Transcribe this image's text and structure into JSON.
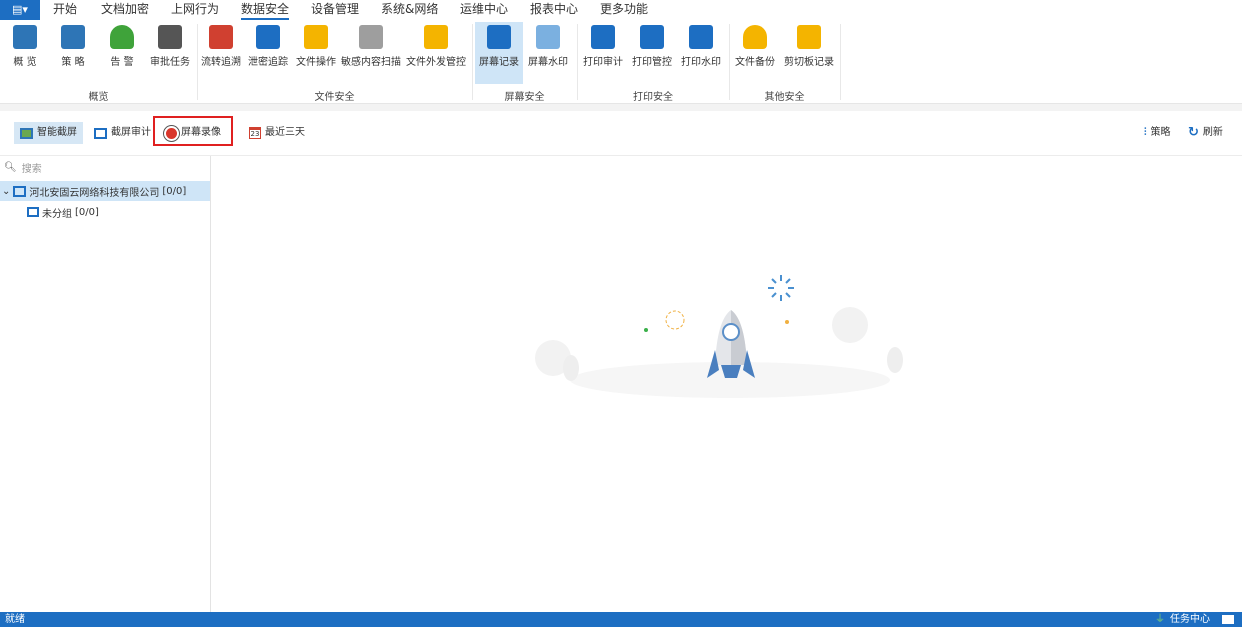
{
  "menu": {
    "app_icon": "app-menu-icon",
    "tabs": [
      "开始",
      "文档加密",
      "上网行为",
      "数据安全",
      "设备管理",
      "系统&网络",
      "运维中心",
      "报表中心",
      "更多功能"
    ],
    "active": "数据安全"
  },
  "ribbon": {
    "items": [
      {
        "label": "概 览",
        "icon": "overview-grid-icon"
      },
      {
        "label": "策 略",
        "icon": "policy-sliders-icon"
      },
      {
        "label": "告 警",
        "icon": "alarm-bell-icon"
      },
      {
        "label": "审批任务",
        "icon": "approval-clipboard-icon"
      },
      {
        "label": "流转追溯",
        "icon": "trace-flow-icon"
      },
      {
        "label": "泄密追踪",
        "icon": "leak-cloud-icon"
      },
      {
        "label": "文件操作",
        "icon": "file-operation-folder-icon"
      },
      {
        "label": "敏感内容扫描",
        "icon": "sensitive-scan-icon"
      },
      {
        "label": "文件外发管控",
        "icon": "file-outgoing-folder-icon"
      },
      {
        "label": "屏幕记录",
        "icon": "screen-record-monitor-icon"
      },
      {
        "label": "屏幕水印",
        "icon": "screen-watermark-icon"
      },
      {
        "label": "打印审计",
        "icon": "printer-icon"
      },
      {
        "label": "打印管控",
        "icon": "printer-shield-icon"
      },
      {
        "label": "打印水印",
        "icon": "print-watermark-icon"
      },
      {
        "label": "文件备份",
        "icon": "file-backup-icon"
      },
      {
        "label": "剪切板记录",
        "icon": "clipboard-icon"
      }
    ],
    "groups": [
      "概览",
      "文件安全",
      "屏幕安全",
      "打印安全",
      "其他安全"
    ]
  },
  "toolbar": {
    "smart_capture": "智能截屏",
    "capture_audit": "截屏审计",
    "screen_video": "屏幕录像",
    "recent": "最近三天",
    "policy": "策略",
    "refresh": "刷新"
  },
  "sidebar": {
    "search_placeholder": "搜索",
    "tree": [
      {
        "label": "河北安固云网络科技有限公司",
        "count": "[0/0]"
      },
      {
        "label": "未分组",
        "count": "[0/0]"
      }
    ]
  },
  "status": {
    "left": "就绪",
    "task_center": "任务中心"
  },
  "colors": {
    "accent": "#1d6ec2",
    "highlight": "#e02020"
  }
}
